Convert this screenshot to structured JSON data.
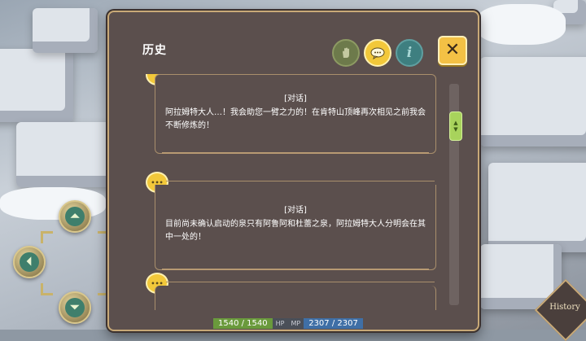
{
  "panel": {
    "title": "历史",
    "tools": {
      "hand_icon": "hand-icon",
      "chat_icon": "speech-bubble-icon",
      "info_glyph": "i",
      "close_glyph": "✕"
    }
  },
  "history": {
    "entries": [
      {
        "tag": "[对话]",
        "text": "阿拉姆特大人…！我会助您一臂之力的！在肯特山顶峰再次相见之前我会不断修炼的！"
      },
      {
        "tag": "[对话]",
        "text": "目前尚未确认启动的泉只有阿鲁阿和杜蕾之泉，阿拉姆特大人分明会在其中一处的！"
      }
    ],
    "bubble_glyph": "•••"
  },
  "stats": {
    "hp_value": "1540 / 1540",
    "hp_label": "HP",
    "mp_label": "MP",
    "mp_value": "2307 / 2307"
  },
  "history_button": {
    "label": "History"
  },
  "controls": {
    "up_glyph": "⏶",
    "left_glyph": "⏴",
    "down_glyph": "⏷"
  },
  "colors": {
    "panel_bg": "#5b4f4d",
    "panel_border": "#c8a977",
    "accent_yellow": "#f2c83a",
    "scroll_green": "#a8d35c"
  }
}
